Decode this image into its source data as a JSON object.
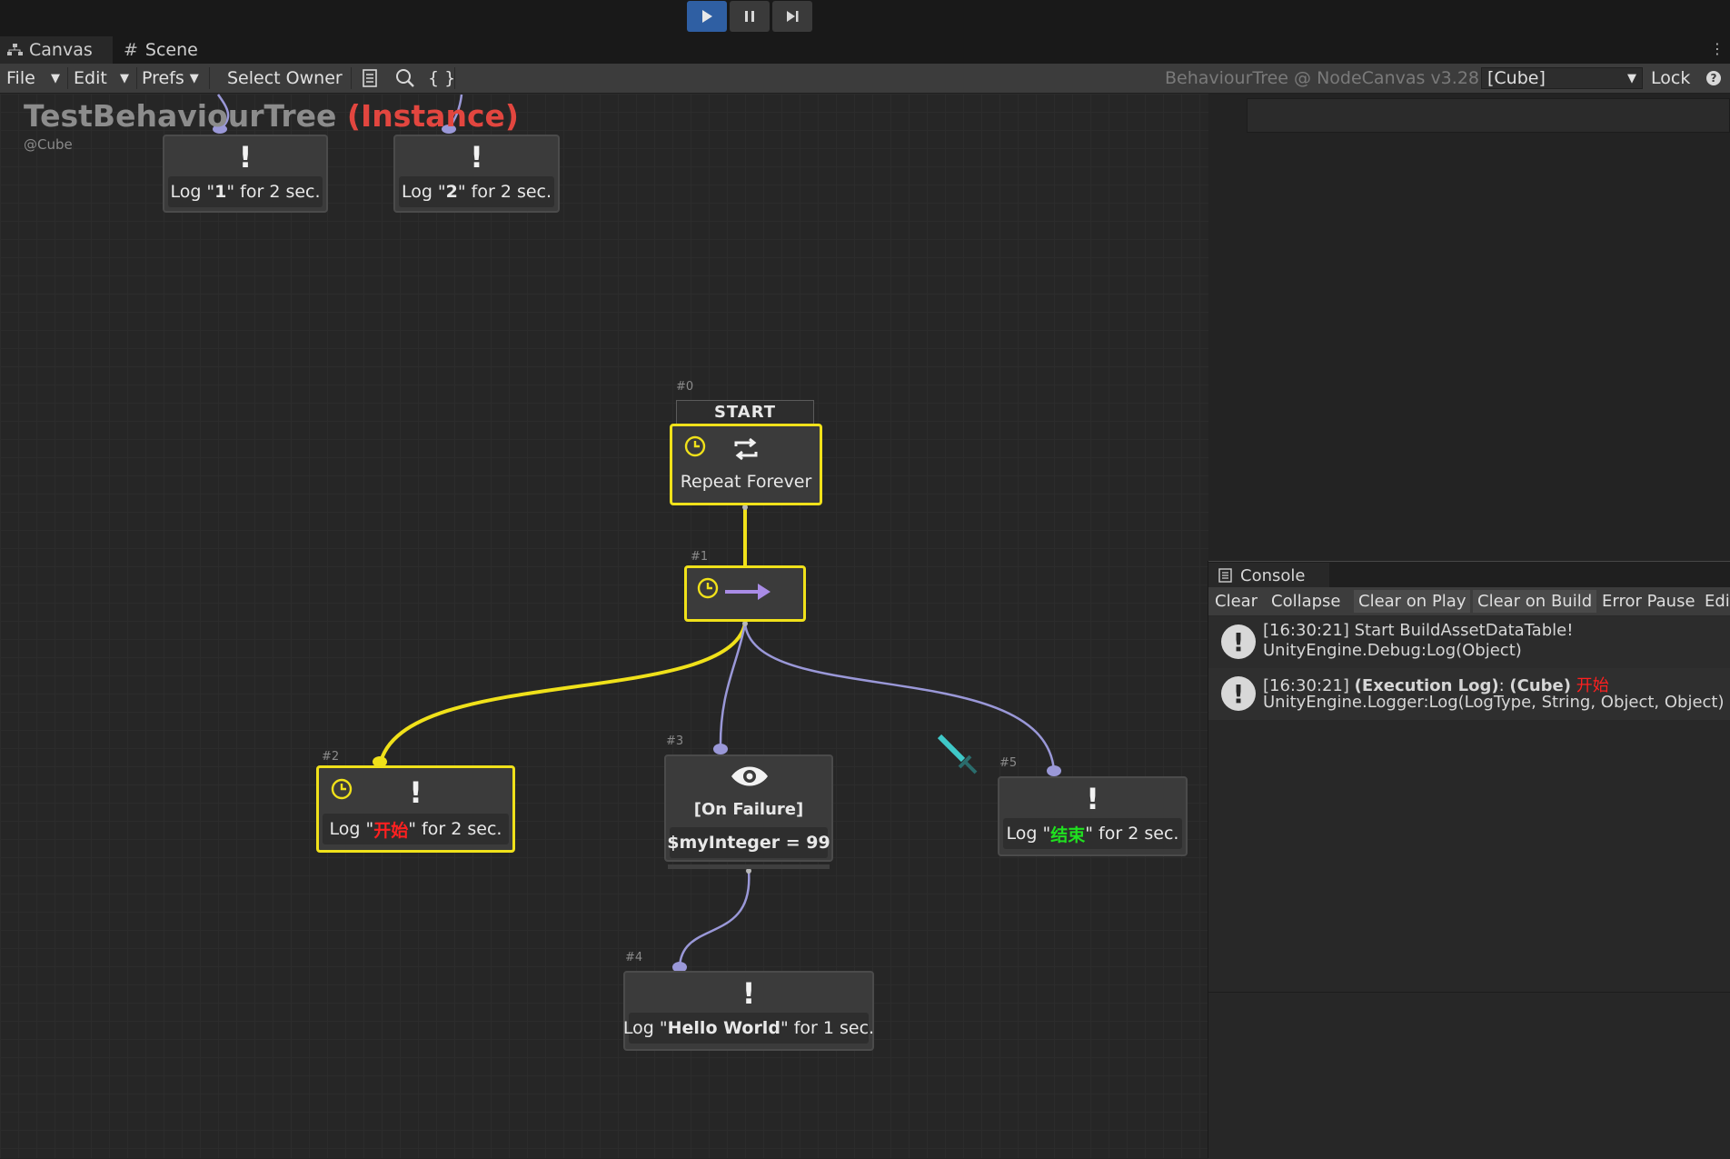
{
  "window": {
    "tabs": [
      {
        "label": "Canvas",
        "icon": "graph-icon",
        "active": true
      },
      {
        "label": "Scene",
        "icon": "grid-icon",
        "active": false
      }
    ]
  },
  "playbar": {
    "play": "play-icon",
    "pause": "pause-icon",
    "step": "step-icon"
  },
  "toolbar": {
    "file": "File",
    "edit": "Edit",
    "prefs": "Prefs",
    "select_owner": "Select Owner",
    "icons": [
      "document-icon",
      "search-icon",
      "braces-icon"
    ],
    "braces_text": "{ }",
    "version": "BehaviourTree @ NodeCanvas v3.28",
    "owner_select": "[Cube]",
    "lock": "Lock",
    "help_icon": "help-icon"
  },
  "graph": {
    "title": "TestBehaviourTree",
    "instance": "(Instance)",
    "owner": "@Cube",
    "start_label": "START",
    "nodes": {
      "n0": {
        "id": "#0",
        "label": "Repeat Forever"
      },
      "n1": {
        "id": "#1"
      },
      "n2": {
        "id": "#2",
        "prefix": "Log \"",
        "msg": "开始",
        "suffix": "\" for 2 sec.",
        "msg_color": "#ff2020"
      },
      "n3": {
        "id": "#3",
        "title": "[On Failure]",
        "condition": "$myInteger = 99"
      },
      "n4": {
        "id": "#4",
        "prefix": "Log \"",
        "msg": "Hello World",
        "suffix": "\" for 1 sec."
      },
      "n5": {
        "id": "#5",
        "prefix": "Log \"",
        "msg": "结束",
        "suffix": "\" for 2 sec.",
        "msg_color": "#20e020"
      },
      "top1": {
        "prefix": "Log \"",
        "msg": "1",
        "suffix": "\" for 2 sec."
      },
      "top2": {
        "prefix": "Log \"",
        "msg": "2",
        "suffix": "\" for 2 sec."
      }
    },
    "colors": {
      "running": "#f0e11a",
      "connection": "#9a98d8",
      "instance": "#e2463f"
    }
  },
  "console": {
    "tab": "Console",
    "buttons": [
      "Clear",
      "Collapse",
      "Clear on Play",
      "Clear on Build",
      "Error Pause",
      "Edi"
    ],
    "entries": [
      {
        "line1": "[16:30:21] Start BuildAssetDataTable!",
        "line2": "UnityEngine.Debug:Log(Object)"
      },
      {
        "time": "[16:30:21] ",
        "bold": "(Execution Log)",
        "mid": ": ",
        "owner": "(Cube)",
        "space": " ",
        "msg": "开始",
        "msg_color": "#ff2020",
        "line2": "UnityEngine.Logger:Log(LogType, String, Object, Object)"
      }
    ]
  }
}
